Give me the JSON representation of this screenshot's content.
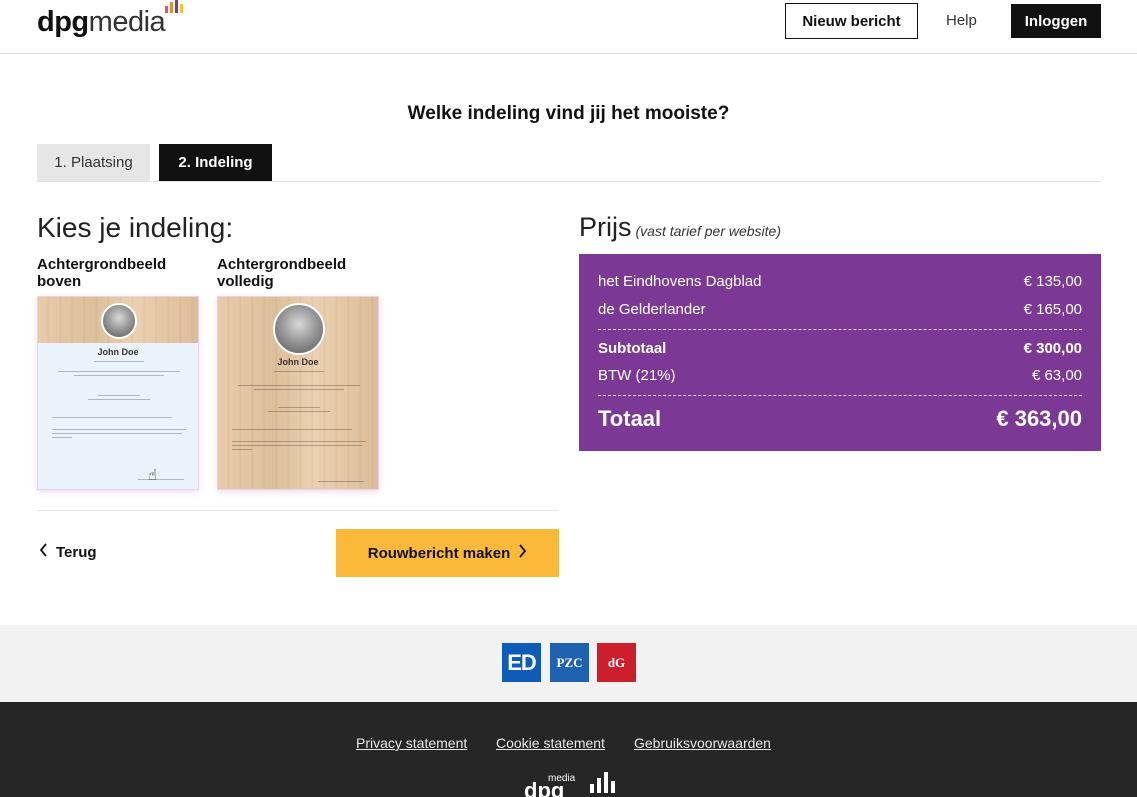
{
  "header": {
    "logo_bold": "dpg",
    "logo_light": "media",
    "new_message": "Nieuw bericht",
    "help": "Help",
    "login": "Inloggen"
  },
  "question": "Welke indeling vind jij het mooiste?",
  "tabs": [
    {
      "label": "1. Plaatsing",
      "active": false
    },
    {
      "label": "2. Indeling",
      "active": true
    }
  ],
  "layout_section": {
    "title": "Kies je indeling:",
    "options": [
      {
        "label": "Achtergrondbeeld boven",
        "card_name": "John Doe"
      },
      {
        "label": "Achtergrondbeeld volledig",
        "card_name": "John Doe"
      }
    ]
  },
  "actions": {
    "back": "Terug",
    "make": "Rouwbericht maken"
  },
  "price": {
    "title": "Prijs",
    "subtitle": "(vast tarief per website)",
    "lines": [
      {
        "label": "het Eindhovens Dagblad",
        "amount": "€ 135,00"
      },
      {
        "label": "de Gelderlander",
        "amount": "€ 165,00"
      }
    ],
    "subtotal": {
      "label": "Subtotaal",
      "amount": "€ 300,00"
    },
    "vat": {
      "label": "BTW (21%)",
      "amount": "€ 63,00"
    },
    "total": {
      "label": "Totaal",
      "amount": "€ 363,00"
    },
    "box_color": "#7b3995"
  },
  "footer": {
    "brands": [
      {
        "name": "ED",
        "color": "#0d5db8"
      },
      {
        "name": "PZC",
        "color": "#1f62b0"
      },
      {
        "name": "dG",
        "color": "#cc1f2b"
      }
    ],
    "links": [
      "Privacy statement",
      "Cookie statement",
      "Gebruiksvoorwaarden"
    ],
    "logo_small": "media",
    "logo_main": "dpg"
  },
  "colors": {
    "accent_button": "#fbb93a",
    "dark": "#111111"
  }
}
